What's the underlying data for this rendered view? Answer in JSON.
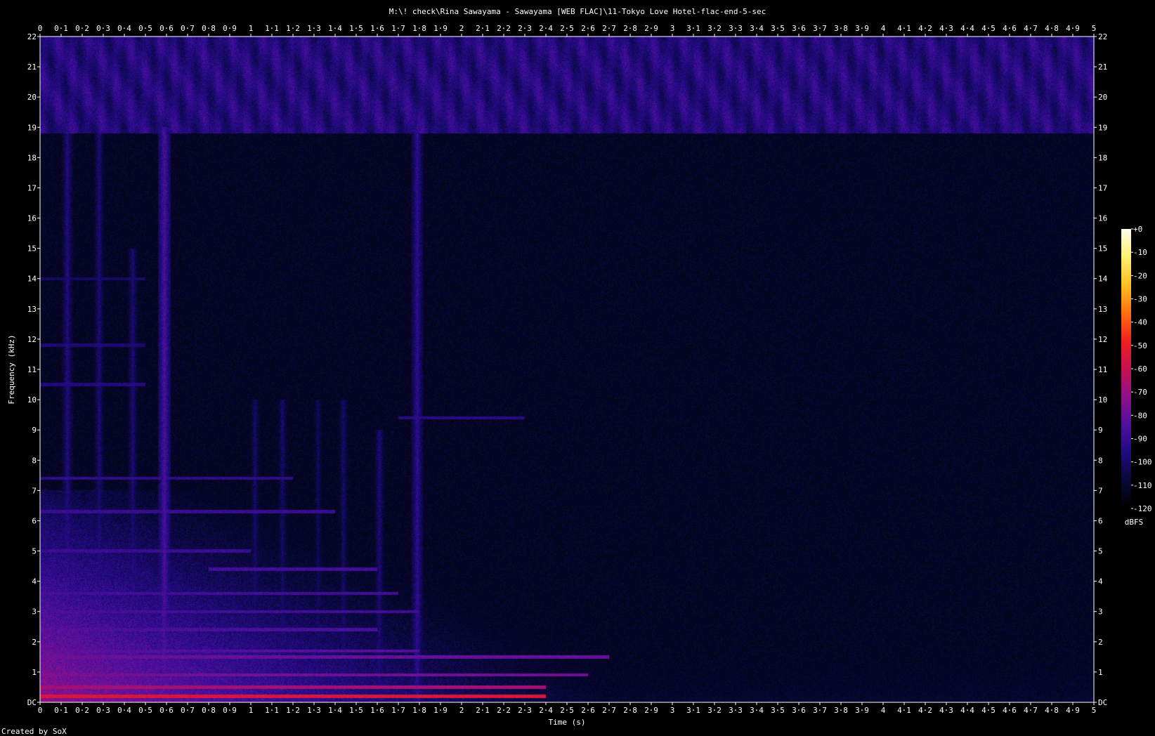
{
  "window": {
    "title": "M:\\! check\\Rina Sawayama - Sawayama [WEB FLAC]\\11-Tokyo Love Hotel-flac-end-5-sec",
    "footer": "Created by SoX"
  },
  "chart_data": {
    "type": "heatmap",
    "title": "M:\\! check\\Rina Sawayama - Sawayama [WEB FLAC]\\11-Tokyo Love Hotel-flac-end-5-sec",
    "xlabel": "Time (s)",
    "ylabel": "Frequency (kHz)",
    "xlim": [
      0,
      5
    ],
    "ylim": [
      0,
      22
    ],
    "x_ticks": [
      "0",
      "0·1",
      "0·2",
      "0·3",
      "0·4",
      "0·5",
      "0·6",
      "0·7",
      "0·8",
      "0·9",
      "1",
      "1·1",
      "1·2",
      "1·3",
      "1·4",
      "1·5",
      "1·6",
      "1·7",
      "1·8",
      "1·9",
      "2",
      "2·1",
      "2·2",
      "2·3",
      "2·4",
      "2·5",
      "2·6",
      "2·7",
      "2·8",
      "2·9",
      "3",
      "3·1",
      "3·2",
      "3·3",
      "3·4",
      "3·5",
      "3·6",
      "3·7",
      "3·8",
      "3·9",
      "4",
      "4·1",
      "4·2",
      "4·3",
      "4·4",
      "4·5",
      "4·6",
      "4·7",
      "4·8",
      "4·9",
      "5"
    ],
    "y_ticks": [
      "DC",
      "1",
      "2",
      "3",
      "4",
      "5",
      "6",
      "7",
      "8",
      "9",
      "10",
      "11",
      "12",
      "13",
      "14",
      "15",
      "16",
      "17",
      "18",
      "19",
      "20",
      "21",
      "22"
    ],
    "colorbar": {
      "label": "dBFS",
      "range": [
        -120,
        0
      ],
      "ticks": [
        "+0",
        "-10",
        "-20",
        "-30",
        "-40",
        "-50",
        "-60",
        "-70",
        "-80",
        "-90",
        "-100",
        "-110",
        "-120"
      ],
      "colors": [
        "#fffcf0",
        "#fff070",
        "#ffc020",
        "#ff7010",
        "#f02020",
        "#c81050",
        "#90108a",
        "#5010a0",
        "#200a80",
        "#080838",
        "#000000"
      ]
    },
    "background_level_db": -112,
    "noise_band_khz": [
      18.8,
      22
    ],
    "noise_band_level_db": -96,
    "transients": [
      {
        "t": 0.13,
        "fmax": 19,
        "db": -96
      },
      {
        "t": 0.28,
        "fmax": 19,
        "db": -98
      },
      {
        "t": 0.44,
        "fmax": 15,
        "db": -98
      },
      {
        "t": 0.59,
        "fmax": 19,
        "db": -86
      },
      {
        "t": 1.02,
        "fmax": 10,
        "db": -100
      },
      {
        "t": 1.15,
        "fmax": 10,
        "db": -100
      },
      {
        "t": 1.32,
        "fmax": 10,
        "db": -102
      },
      {
        "t": 1.44,
        "fmax": 10,
        "db": -100
      },
      {
        "t": 1.61,
        "fmax": 9,
        "db": -98
      },
      {
        "t": 1.79,
        "fmax": 19,
        "db": -92
      }
    ],
    "harmonics": [
      {
        "f": 0.2,
        "t0": 0,
        "t1": 2.4,
        "db": -55
      },
      {
        "f": 0.5,
        "t0": 0,
        "t1": 2.4,
        "db": -68
      },
      {
        "f": 0.9,
        "t0": 0,
        "t1": 2.6,
        "db": -78
      },
      {
        "f": 1.5,
        "t0": 0,
        "t1": 2.7,
        "db": -80
      },
      {
        "f": 1.7,
        "t0": 0,
        "t1": 1.8,
        "db": -84
      },
      {
        "f": 2.4,
        "t0": 0,
        "t1": 1.6,
        "db": -86
      },
      {
        "f": 3.0,
        "t0": 0,
        "t1": 1.8,
        "db": -88
      },
      {
        "f": 3.6,
        "t0": 0,
        "t1": 1.7,
        "db": -88
      },
      {
        "f": 4.4,
        "t0": 0.8,
        "t1": 1.6,
        "db": -88
      },
      {
        "f": 5.0,
        "t0": 0,
        "t1": 1.0,
        "db": -90
      },
      {
        "f": 6.3,
        "t0": 0,
        "t1": 1.4,
        "db": -90
      },
      {
        "f": 7.4,
        "t0": 0,
        "t1": 1.2,
        "db": -92
      },
      {
        "f": 9.4,
        "t0": 1.7,
        "t1": 2.3,
        "db": -94
      },
      {
        "f": 10.5,
        "t0": 0,
        "t1": 0.5,
        "db": -96
      },
      {
        "f": 11.8,
        "t0": 0,
        "t1": 0.5,
        "db": -98
      },
      {
        "f": 14.0,
        "t0": 0,
        "t1": 0.5,
        "db": -100
      }
    ],
    "low_energy_db_start": -72,
    "low_energy_fade_end_s": 2.7
  }
}
